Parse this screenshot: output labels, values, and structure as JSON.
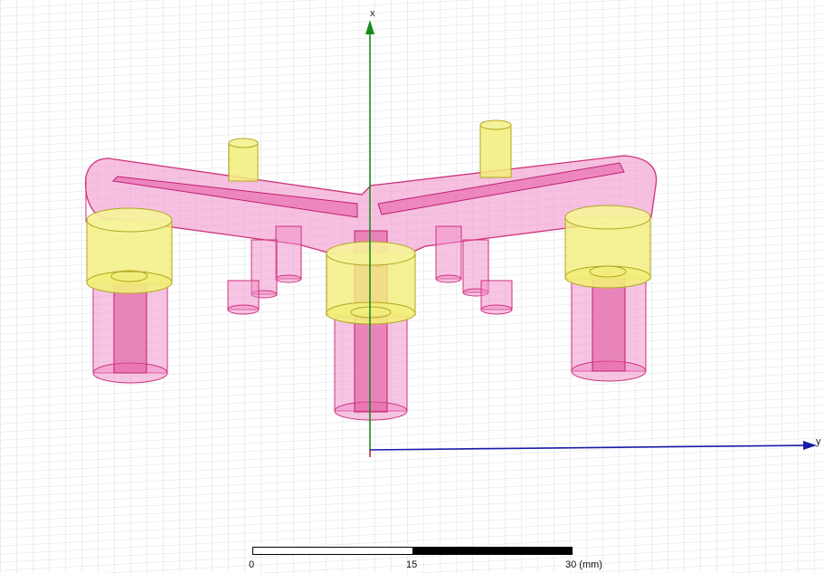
{
  "viewport": {
    "axes": {
      "x_label": "x",
      "y_label": "y"
    },
    "colors": {
      "x_axis": "#1a8a1a",
      "y_axis": "#1a1aaa",
      "body_fill": "#f08cc8",
      "body_stroke": "#d0307a",
      "yellow_fill": "#f2ee7a",
      "yellow_stroke": "#b0a820",
      "grid": "#cfd4da"
    }
  },
  "scale_bar": {
    "ticks": [
      "0",
      "15",
      "30 (mm)"
    ]
  }
}
